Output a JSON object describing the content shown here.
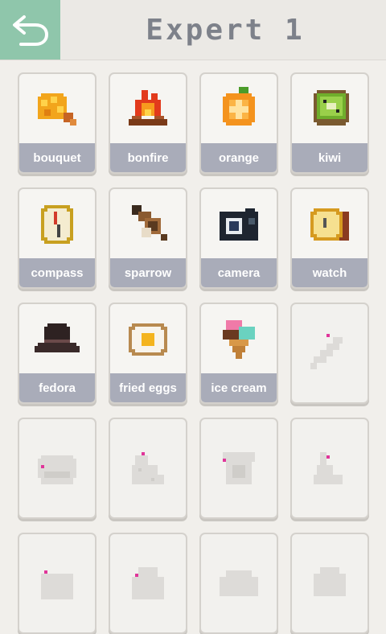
{
  "header": {
    "title": "Expert 1",
    "back_icon": "back-arrow-icon"
  },
  "colors": {
    "accent": "#8fc6ab",
    "label_bar": "#a9acb9",
    "title": "#7d818a",
    "locked_gray": "#dddbd8",
    "locked_dot": "#e0359a"
  },
  "puzzles": [
    {
      "label": "bouquet",
      "icon": "bouquet-icon",
      "solved": true
    },
    {
      "label": "bonfire",
      "icon": "bonfire-icon",
      "solved": true
    },
    {
      "label": "orange",
      "icon": "orange-icon",
      "solved": true
    },
    {
      "label": "kiwi",
      "icon": "kiwi-icon",
      "solved": true
    },
    {
      "label": "compass",
      "icon": "compass-icon",
      "solved": true
    },
    {
      "label": "sparrow",
      "icon": "sparrow-icon",
      "solved": true
    },
    {
      "label": "camera",
      "icon": "camera-icon",
      "solved": true
    },
    {
      "label": "watch",
      "icon": "watch-icon",
      "solved": true
    },
    {
      "label": "fedora",
      "icon": "fedora-icon",
      "solved": true
    },
    {
      "label": "fried eggs",
      "icon": "fried-eggs-icon",
      "solved": true
    },
    {
      "label": "ice cream",
      "icon": "ice-cream-icon",
      "solved": true
    },
    {
      "label": "",
      "icon": "locked-feather-icon",
      "solved": false
    },
    {
      "label": "",
      "icon": "locked-bread-icon",
      "solved": false
    },
    {
      "label": "",
      "icon": "locked-cheese-icon",
      "solved": false
    },
    {
      "label": "",
      "icon": "locked-phone-icon",
      "solved": false
    },
    {
      "label": "",
      "icon": "locked-rabbit-icon",
      "solved": false
    }
  ]
}
